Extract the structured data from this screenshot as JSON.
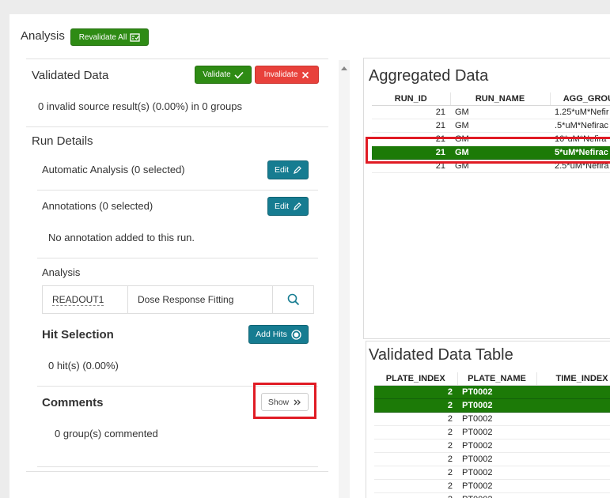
{
  "header": {
    "title": "Analysis",
    "revalidate_label": "Revalidate All"
  },
  "validated": {
    "title": "Validated Data",
    "validate_label": "Validate",
    "invalidate_label": "Invalidate",
    "summary": "0 invalid source result(s) (0.00%) in 0 groups"
  },
  "run_details": {
    "title": "Run Details",
    "automatic_analysis": "Automatic Analysis (0 selected)",
    "edit_label": "Edit",
    "annotations": "Annotations (0 selected)",
    "no_annotation": "No annotation added to this run.",
    "analysis_label": "Analysis",
    "analysis_readout": "READOUT1",
    "analysis_method": "Dose Response Fitting"
  },
  "hit_selection": {
    "title": "Hit Selection",
    "add_hits_label": "Add Hits",
    "summary": "0 hit(s) (0.00%)"
  },
  "comments": {
    "title": "Comments",
    "show_label": "Show",
    "summary": "0 group(s) commented"
  },
  "aggregated": {
    "title": "Aggregated Data",
    "columns": [
      "RUN_ID",
      "RUN_NAME",
      "AGG_GROUP"
    ],
    "rows": [
      [
        "21",
        "GM",
        "1.25*uM*Nefir"
      ],
      [
        "21",
        "GM",
        ".5*uM*Nefirac"
      ],
      [
        "21",
        "GM",
        "10*uM*Nefira"
      ],
      [
        "21",
        "GM",
        "5*uM*Nefirac"
      ],
      [
        "21",
        "GM",
        "2.5*uM*Nefira"
      ]
    ]
  },
  "validated_table": {
    "title": "Validated Data Table",
    "columns": [
      "PLATE_INDEX",
      "PLATE_NAME",
      "TIME_INDEX"
    ],
    "rows": [
      [
        "2",
        "PT0002",
        ""
      ],
      [
        "2",
        "PT0002",
        ""
      ],
      [
        "2",
        "PT0002",
        ""
      ],
      [
        "2",
        "PT0002",
        ""
      ],
      [
        "2",
        "PT0002",
        ""
      ],
      [
        "2",
        "PT0002",
        ""
      ],
      [
        "2",
        "PT0002",
        ""
      ],
      [
        "2",
        "PT0002",
        ""
      ],
      [
        "2",
        "PT0002",
        ""
      ]
    ]
  },
  "colors": {
    "green": "#2e8b14",
    "red": "#e8413b",
    "teal": "#167c91",
    "selected_row": "#1c7a07",
    "highlight": "#e01b24"
  },
  "icons": [
    "clipboard-check-icon",
    "check-icon",
    "close-icon",
    "pencil-icon",
    "search-icon",
    "target-icon",
    "chevron-double-right-icon",
    "scroll-up-arrow-icon"
  ]
}
